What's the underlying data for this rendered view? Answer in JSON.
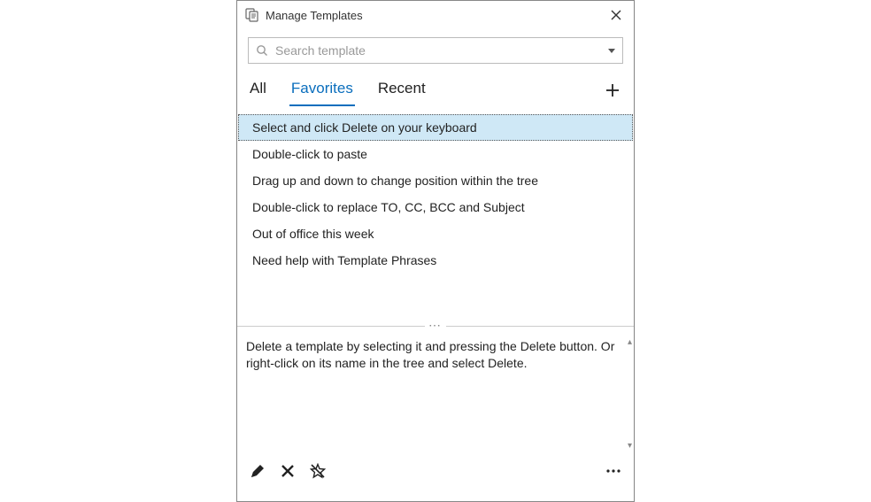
{
  "titlebar": {
    "title": "Manage Templates"
  },
  "search": {
    "placeholder": "Search template"
  },
  "tabs": {
    "items": [
      {
        "label": "All"
      },
      {
        "label": "Favorites"
      },
      {
        "label": "Recent"
      }
    ],
    "active_index": 1
  },
  "list": {
    "items": [
      {
        "label": "Select and click Delete on your keyboard",
        "selected": true
      },
      {
        "label": "Double-click to paste",
        "selected": false
      },
      {
        "label": "Drag up and down to change position within the tree",
        "selected": false
      },
      {
        "label": "Double-click to replace TO, CC, BCC and Subject",
        "selected": false
      },
      {
        "label": "Out of office this week",
        "selected": false
      },
      {
        "label": "Need help with Template Phrases",
        "selected": false
      }
    ]
  },
  "preview": {
    "text": "Delete a template by selecting it and pressing the Delete button. Or right-click on its name in the tree and select Delete."
  },
  "toolbar": {
    "icons": [
      "edit",
      "delete",
      "unfavorite"
    ]
  }
}
